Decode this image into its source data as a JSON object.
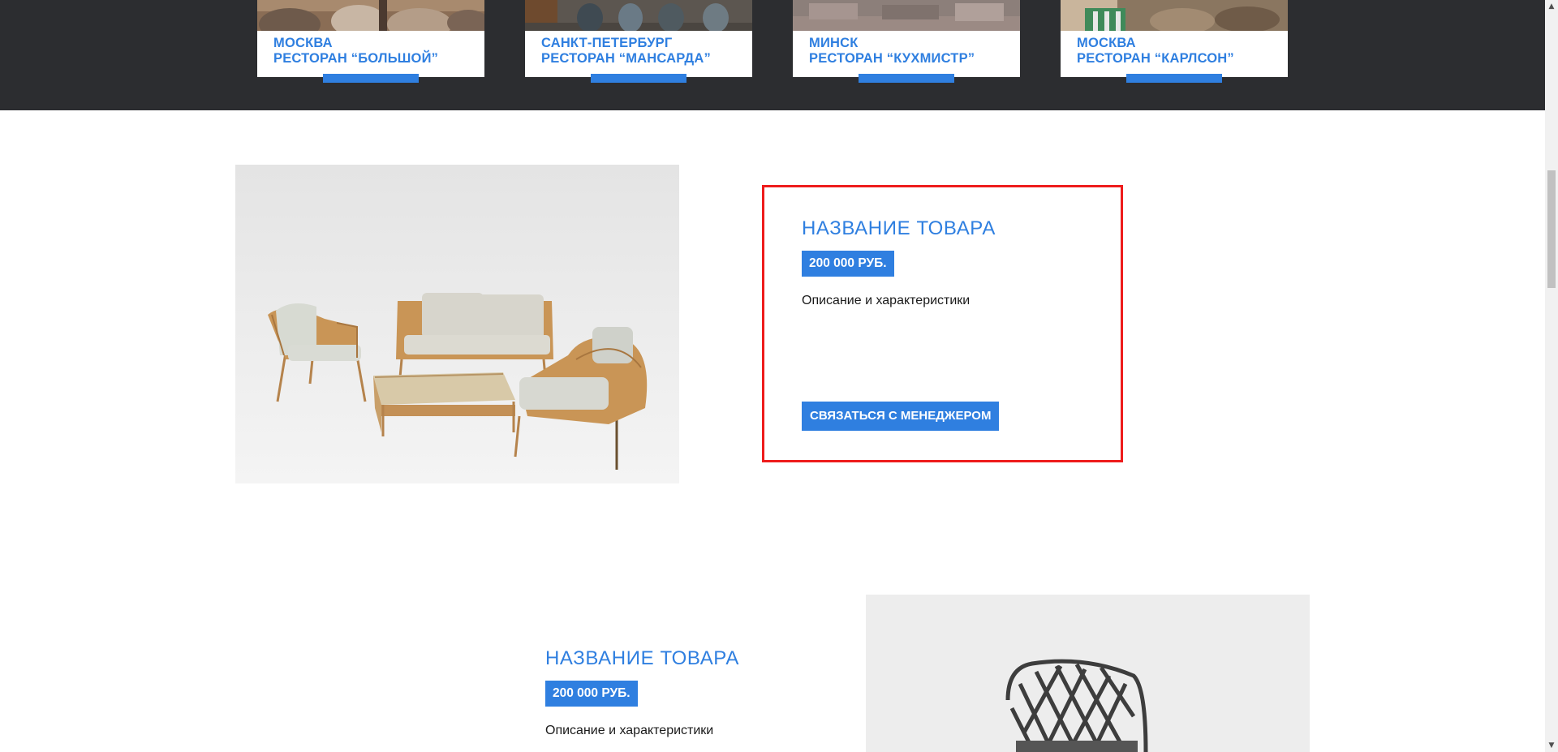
{
  "restaurants": [
    {
      "city": "МОСКВА",
      "name": "РЕСТОРАН “БОЛЬШОЙ”"
    },
    {
      "city": "САНКТ-ПЕТЕРБУРГ",
      "name": "РЕСТОРАН “МАНСАРДА”"
    },
    {
      "city": "МИНСК",
      "name": "РЕСТОРАН “КУХМИСТР”"
    },
    {
      "city": "МОСКВА",
      "name": "РЕСТОРАН “КАРЛСОН”"
    }
  ],
  "products": [
    {
      "title": "НАЗВАНИЕ ТОВАРА",
      "price": "200 000 РУБ.",
      "description": "Описание и характеристики",
      "button": "СВЯЗАТЬСЯ С МЕНЕДЖЕРОМ"
    },
    {
      "title": "НАЗВАНИЕ ТОВАРА",
      "price": "200 000 РУБ.",
      "description": "Описание и характеристики"
    }
  ],
  "colors": {
    "accent": "#2f7fe0",
    "dark_band": "#2c2d30",
    "highlight": "#ee1c1c"
  },
  "scrollbar": {
    "up_icon": "triangle-up-icon",
    "down_icon": "triangle-down-icon"
  }
}
